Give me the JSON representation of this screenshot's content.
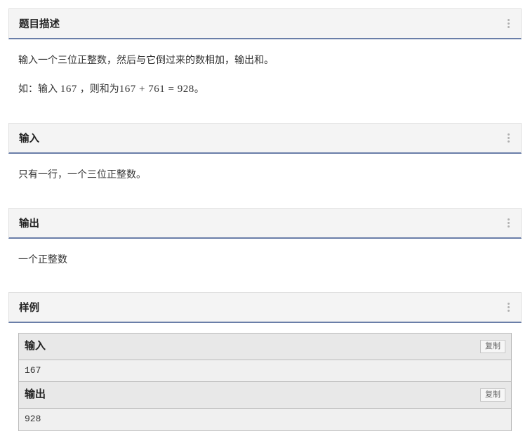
{
  "sections": {
    "description": {
      "title": "题目描述",
      "line1": "输入一个三位正整数，然后与它倒过来的数相加，输出和。",
      "line2_prefix": "如：输入 ",
      "line2_expr_a": "167",
      "line2_mid": " ，则和为",
      "line2_expr_b": "167 + 761 = 928",
      "line2_suffix": "。"
    },
    "input": {
      "title": "输入",
      "body": "只有一行，一个三位正整数。"
    },
    "output": {
      "title": "输出",
      "body": "一个正整数"
    },
    "sample": {
      "title": "样例",
      "input_label": "输入",
      "input_value": "167",
      "output_label": "输出",
      "output_value": "928",
      "copy_label": "复制"
    }
  }
}
